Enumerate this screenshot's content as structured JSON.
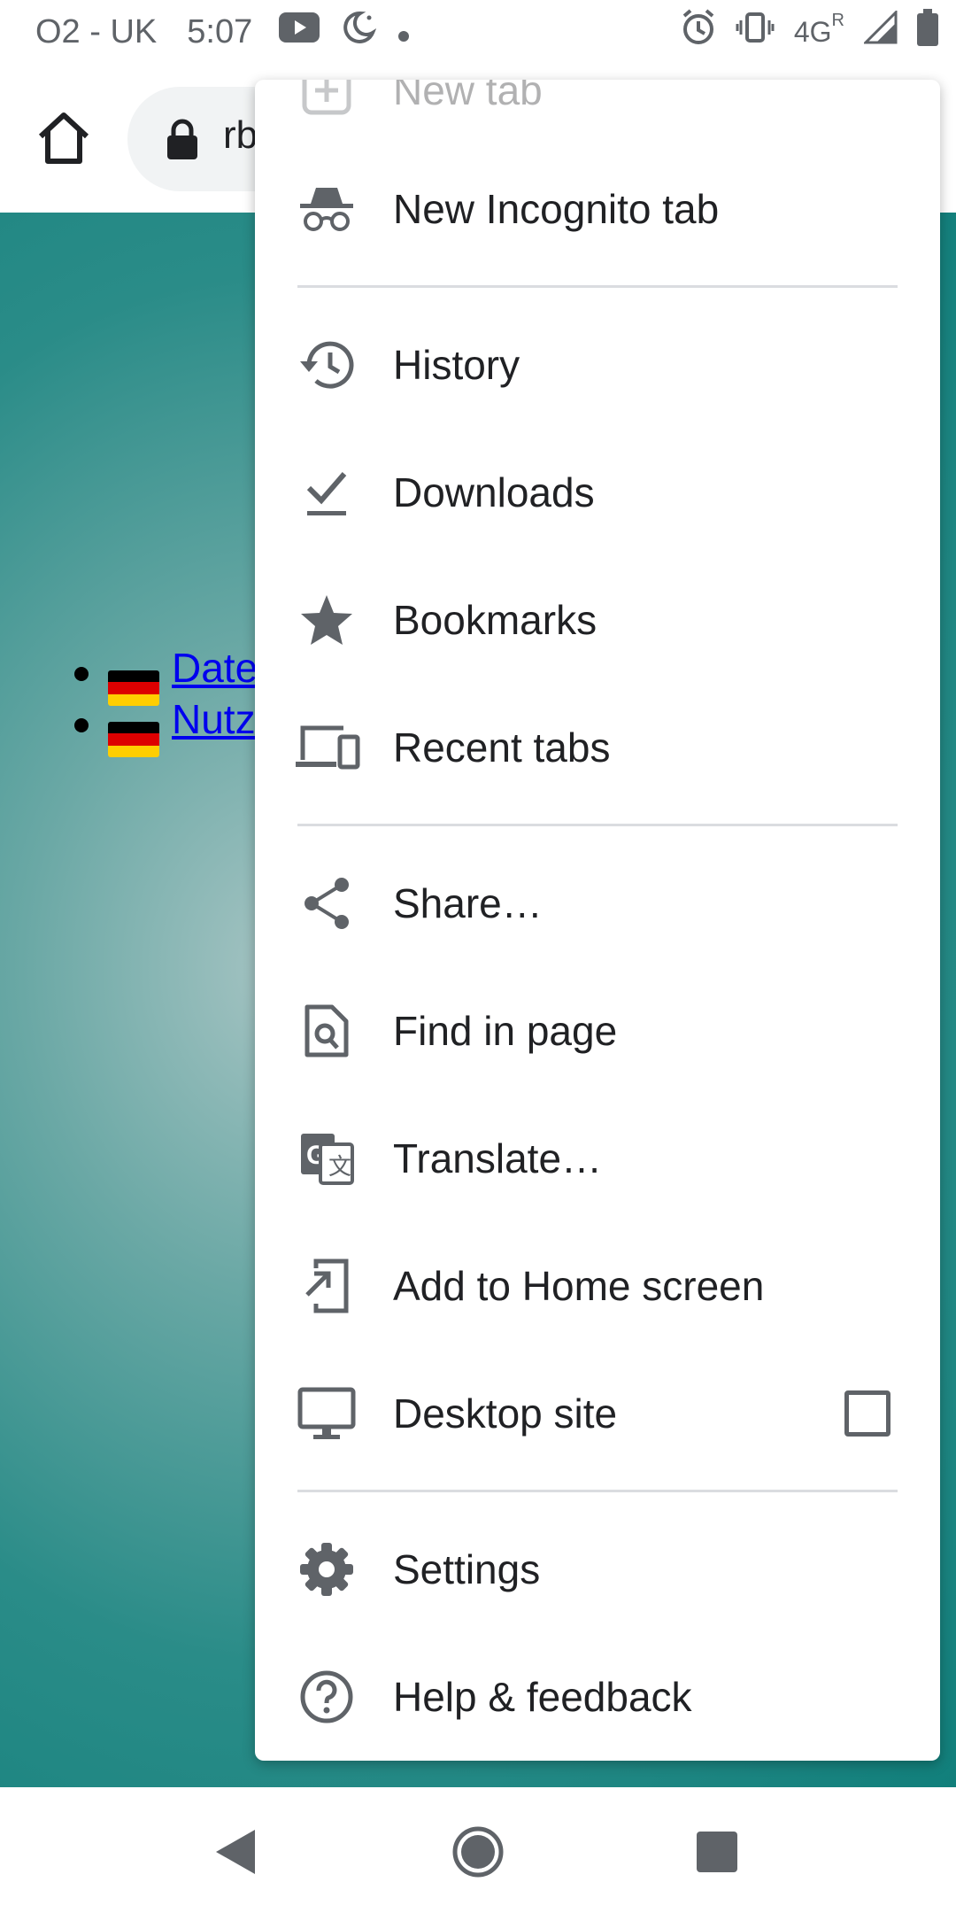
{
  "status_bar": {
    "carrier": "O2 - UK",
    "time": "5:07",
    "network": "4G",
    "roaming": "R"
  },
  "toolbar": {
    "url": "rb"
  },
  "page": {
    "links": [
      {
        "text": "Date"
      },
      {
        "text": "Nutz"
      }
    ]
  },
  "menu": {
    "items": [
      {
        "label": "New tab",
        "icon": "new-tab-icon"
      },
      {
        "label": "New Incognito tab",
        "icon": "incognito-icon"
      },
      {
        "label": "History",
        "icon": "history-icon"
      },
      {
        "label": "Downloads",
        "icon": "downloads-icon"
      },
      {
        "label": "Bookmarks",
        "icon": "star-icon"
      },
      {
        "label": "Recent tabs",
        "icon": "devices-icon"
      },
      {
        "label": "Share…",
        "icon": "share-icon"
      },
      {
        "label": "Find in page",
        "icon": "find-in-page-icon"
      },
      {
        "label": "Translate…",
        "icon": "translate-icon"
      },
      {
        "label": "Add to Home screen",
        "icon": "add-to-home-icon"
      },
      {
        "label": "Desktop site",
        "icon": "desktop-icon",
        "checked": false
      },
      {
        "label": "Settings",
        "icon": "gear-icon"
      },
      {
        "label": "Help & feedback",
        "icon": "help-icon"
      }
    ]
  },
  "colors": {
    "icon": "#5f6368",
    "divider": "#dadce0",
    "page_bg": "#117f7b",
    "link": "#0000ee"
  }
}
